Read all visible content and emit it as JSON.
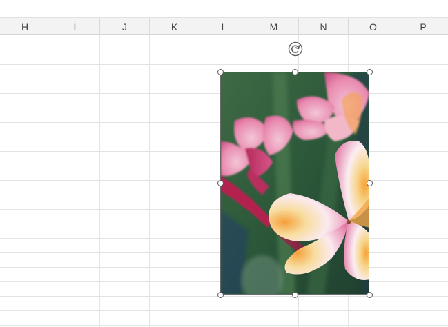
{
  "columns": [
    "H",
    "I",
    "J",
    "K",
    "L",
    "M",
    "N",
    "O",
    "P"
  ],
  "picture": {
    "name": "Frangipani flower photo",
    "selected": true
  },
  "colors": {
    "header_bg": "#f3f3f3",
    "header_text": "#444444",
    "gridline": "#e3e3e3",
    "handle_border": "#5a5a5a"
  },
  "icons": {
    "rotate": "rotate-handle-icon",
    "resize": "resize-handle-icon"
  }
}
